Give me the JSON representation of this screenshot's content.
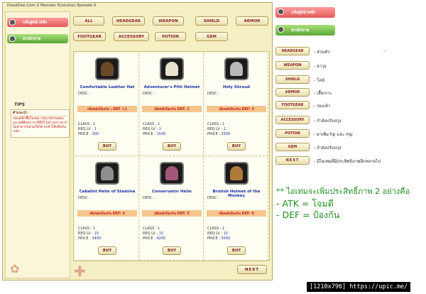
{
  "window": {
    "title": "DoodDee.Com X Monster Evolution Episode II"
  },
  "sidebar": {
    "banner_top": "กลับสู่หน้าหลัก",
    "banner_bottom": "ยกเลิกขาย",
    "tips_label": "TIPS",
    "tips_title": "คำแนะนำ",
    "tips_text": "ก่อนคลิกซื้อไอเทม กรุณาตรวจสอบเลเวลที่ต้องการ (REQ LV) เพราะหากไม่สามารถสวมใส่ได้ จะทำให้เสียเงินเปล่า"
  },
  "tabs": [
    "ALL",
    "HEADGEAR",
    "WEAPON",
    "SHIELD",
    "ARMOR",
    "FOOTGEAR",
    "ACCESSORY",
    "POTION",
    "GEM"
  ],
  "labels": {
    "desc": "DESC :",
    "class": "CLASS :",
    "req": "REQ LV :",
    "price": "PRICE :",
    "buy": "BUY"
  },
  "items": [
    {
      "name": "Comfortable Leather Hat",
      "bonus": "เพิ่มพลังป้องกัน : DEF +1",
      "class": "1",
      "req": "1",
      "price": "300",
      "color": "#6b4a2a"
    },
    {
      "name": "Adventurer's Pith Helmet",
      "bonus": "เพิ่มพลังป้องกัน DEF: 2",
      "class": "1",
      "req": "1",
      "price": "1500",
      "color": "#e8e2cf"
    },
    {
      "name": "Holy Shroud",
      "bonus": "เพิ่มพลังป้องกัน DEF: 3",
      "class": "1",
      "req": "1",
      "price": "2500",
      "color": "#b9b9b9"
    },
    {
      "name": "Cabalist Helm of Stamina",
      "bonus": "เพิ่มพลังป้องกัน DEF: 4",
      "class": "1",
      "req": "15",
      "price": "3400",
      "color": "#8e8e8e"
    },
    {
      "name": "Conservator Helm",
      "bonus": "เพิ่มพลังป้องกัน DEF: 5",
      "class": "1",
      "req": "15",
      "price": "4200",
      "color": "#a3577a"
    },
    {
      "name": "Brutish Helmet of the Monkey",
      "bonus": "เพิ่มพลังป้องกัน DEF: 6",
      "class": "1",
      "req": "15",
      "price": "5000",
      "color": "#b07a3a"
    }
  ],
  "next_label": "NEXT",
  "right_panel": {
    "banner_top": "กลับสู่หน้าหลัก",
    "banner_bottom": "ยกเลิกขาย",
    "rows": [
      {
        "btn": "HEADGEAR",
        "desc": "- ส่วนหัว"
      },
      {
        "btn": "WEAPON",
        "desc": "- อาวุธ"
      },
      {
        "btn": "SHIELD",
        "desc": "- โล่ห์"
      },
      {
        "btn": "ARMOR",
        "desc": "- เสื้อเกาะ"
      },
      {
        "btn": "FOOTGEAR",
        "desc": "- รองเท้า"
      },
      {
        "btn": "ACCESSORY",
        "desc": "- กำลังปรับปรุง"
      },
      {
        "btn": "POTION",
        "desc": "- ยาเพิ่ม hp และ mp"
      },
      {
        "btn": "GEM",
        "desc": "- กำลังปรับปรุง"
      },
      {
        "btn": "NEXT",
        "desc": "- มีไอเทมที่มีประสิทธิภาพอีกหลายไป"
      }
    ],
    "dash": "-",
    "note_line1": "** ไอเทมจะเพิ่มประสิทธิ์ภาพ 2 อย่างคือ",
    "note_line2": "- ATK = โจมตี",
    "note_line3": "- DEF = ป้องกัน"
  },
  "watermark": "[1210x796] https://upic.me/"
}
